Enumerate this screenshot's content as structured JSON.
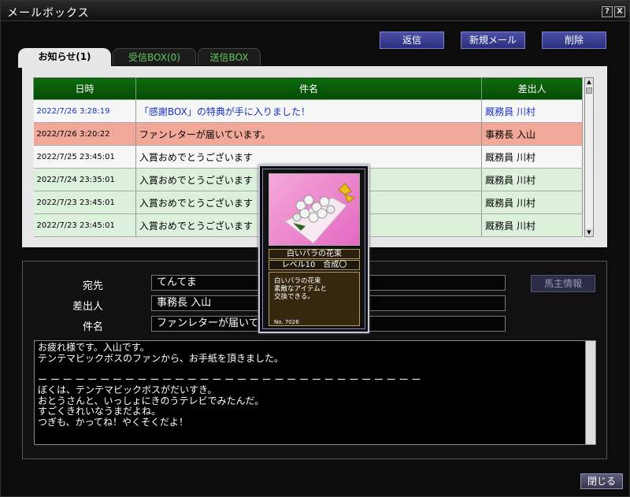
{
  "window": {
    "title": "メールボックス",
    "help": "?",
    "close": "X"
  },
  "toolbar": {
    "reply": "返信",
    "new_mail": "新規メール",
    "delete": "削除"
  },
  "tabs": [
    {
      "label": "お知らせ(1)"
    },
    {
      "label": "受信BOX(0)"
    },
    {
      "label": "送信BOX"
    }
  ],
  "list": {
    "columns": [
      "日時",
      "件名",
      "差出人"
    ],
    "rows": [
      {
        "date": "2022/7/26 3:28:19",
        "subject": "「感謝BOX」の特典が手に入りました！",
        "sender": "厩務員 川村"
      },
      {
        "date": "2022/7/26 3:20:22",
        "subject": "ファンレターが届いています。",
        "sender": "事務長 入山"
      },
      {
        "date": "2022/7/25 23:45:01",
        "subject": "入賞おめでとうございます",
        "sender": "厩務員 川村"
      },
      {
        "date": "2022/7/24 23:35:01",
        "subject": "入賞おめでとうございます",
        "sender": "厩務員 川村"
      },
      {
        "date": "2022/7/23 23:45:01",
        "subject": "入賞おめでとうございます",
        "sender": "厩務員 川村"
      },
      {
        "date": "2022/7/23 23:45:01",
        "subject": "入賞おめでとうございます",
        "sender": "厩務員 川村"
      }
    ]
  },
  "detail": {
    "to_label": "宛先",
    "to_value": "てんてま",
    "from_label": "差出人",
    "from_value": "事務長 入山",
    "subject_label": "件名",
    "subject_value": "ファンレターが届いてい",
    "horse_info": "馬主情報",
    "body": "お疲れ様です。入山です。\nテンテマビックボスのファンから、お手紙を頂きました。\n\nー ー ー ー ー ー ー ー ー ー ー ー ー ー ー ー ー ー ー ー ー ー ー ー ー ー ー ー ー ー ー\nぼくは、テンテマビックボスがだいすき。\nおとうさんと、いっしょにきのうテレビでみたんだ。\nすごくきれいなうまだよね。\nつぎも、かってね！やくそくだよ！"
  },
  "card": {
    "name": "白いバラの花束",
    "level": "レベル10　合成〇",
    "description": "白いバラの花束\n素敵なアイテムと\n交換できる。",
    "number": "No. 7026"
  },
  "footer": {
    "close": "閉じる"
  }
}
